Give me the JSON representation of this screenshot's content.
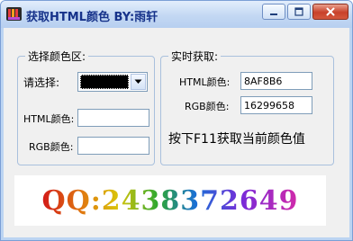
{
  "window": {
    "title": "获取HTML颜色 BY:雨轩",
    "icon": "app-icon"
  },
  "select_group": {
    "label": "选择颜色区:",
    "choose_label": "请选择:",
    "selected_color": "#000000",
    "html_label": "HTML颜色:",
    "html_value": "",
    "rgb_label": "RGB颜色:",
    "rgb_value": ""
  },
  "realtime_group": {
    "label": "实时获取:",
    "html_label": "HTML颜色:",
    "html_value": "8AF8B6",
    "rgb_label": "RGB颜色:",
    "rgb_value": "16299658",
    "hint": "按下F11获取当前颜色值"
  },
  "banner": {
    "text": "QQ:2438372649"
  }
}
